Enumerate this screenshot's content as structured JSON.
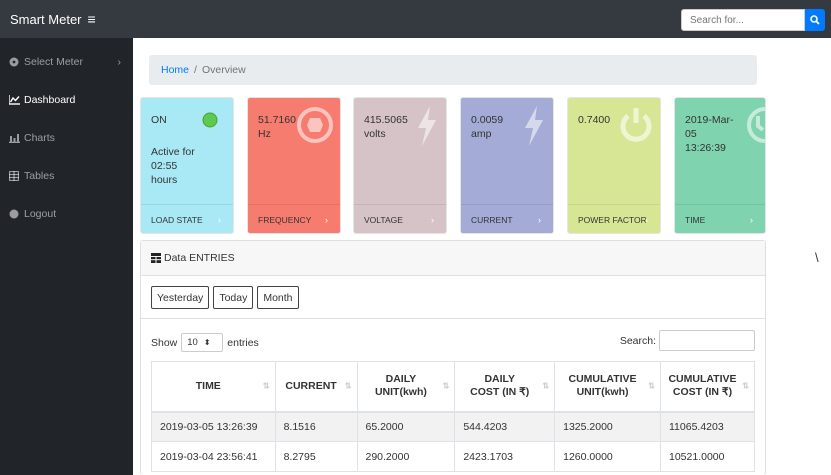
{
  "topnav": {
    "brand": "Smart Meter",
    "menu_icon": "hamburger-icon",
    "search_placeholder": "Search for...",
    "search_icon": "search-icon"
  },
  "sidebar": {
    "items": [
      {
        "label": "Select Meter",
        "icon": "meter-icon",
        "caret": "›"
      },
      {
        "label": "Dashboard",
        "icon": "area-chart-icon"
      },
      {
        "label": "Charts",
        "icon": "bar-chart-icon"
      },
      {
        "label": "Tables",
        "icon": "table-icon"
      },
      {
        "label": "Logout",
        "icon": "logout-icon"
      }
    ]
  },
  "breadcrumb": {
    "home": "Home",
    "sep": "/",
    "current": "Overview"
  },
  "cards": [
    {
      "value": "ON",
      "sub_lines": [
        "Active for",
        "02:55",
        "hours"
      ],
      "footer": "LOAD STATE",
      "color": "#a8e9f5",
      "icon": "status-dot-icon"
    },
    {
      "value_lines": [
        "51.7160",
        "Hz"
      ],
      "footer": "FREQUENCY",
      "color": "#f77c70",
      "icon": "gauge-icon"
    },
    {
      "value_lines": [
        "415.5065",
        "volts"
      ],
      "footer": "VOLTAGE",
      "color": "#d6c3c8",
      "icon": "bolt-icon"
    },
    {
      "value_lines": [
        "0.0059",
        "amp"
      ],
      "footer": "CURRENT",
      "color": "#a4abd6",
      "icon": "bolt-icon"
    },
    {
      "value_lines": [
        "0.7400"
      ],
      "footer": "POWER FACTOR",
      "color": "#d7e695",
      "icon": "power-icon"
    },
    {
      "value_lines": [
        "2019-Mar-",
        "05",
        "13:26:39"
      ],
      "footer": "TIME",
      "color": "#7fd3af",
      "icon": "clock-icon"
    }
  ],
  "footer_chevron": "›",
  "panel": {
    "title": "Data ENTRIES",
    "title_icon": "table-icon",
    "buttons": [
      "Yesterday",
      "Today",
      "Month"
    ],
    "show_label": "Show",
    "entries_value": "10",
    "entries_label": "entries",
    "search_label": "Search:"
  },
  "table": {
    "headers": [
      {
        "l1": "TIME",
        "l2": ""
      },
      {
        "l1": "CURRENT",
        "l2": ""
      },
      {
        "l1": "DAILY",
        "l2": "UNIT(kwh)"
      },
      {
        "l1": "DAILY",
        "l2": "COST (IN ₹)"
      },
      {
        "l1": "CUMULATIVE",
        "l2": "UNIT(kwh)"
      },
      {
        "l1": "CUMULATIVE",
        "l2": "COST (IN ₹)"
      }
    ],
    "sort_glyph": "⇅",
    "rows": [
      [
        "2019-03-05 13:26:39",
        "8.1516",
        "65.2000",
        "544.4203",
        "1325.2000",
        "11065.4203"
      ],
      [
        "2019-03-04 23:56:41",
        "8.2795",
        "290.2000",
        "2423.1703",
        "1260.0000",
        "10521.0000"
      ]
    ]
  },
  "right_glyph": "\\"
}
